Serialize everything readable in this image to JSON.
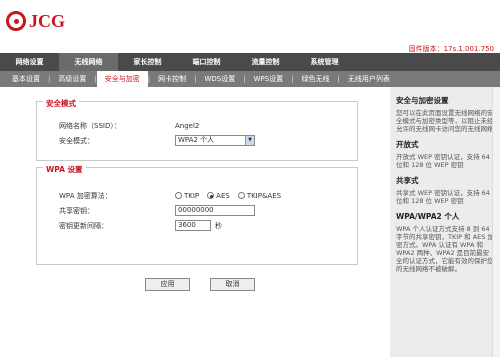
{
  "brand": {
    "name": "JCG",
    "color": "#c8161d"
  },
  "firmware": "固件版本：17s.1.001.750",
  "main_nav": [
    "网络设置",
    "无线网络",
    "家长控制",
    "端口控制",
    "流量控制",
    "系统管理"
  ],
  "main_nav_active": 1,
  "sub_nav": [
    "基本设置",
    "高级设置",
    "安全与加密",
    "网卡控制",
    "WDS设置",
    "WPS设置",
    "绿色无线",
    "无线用户列表"
  ],
  "sub_nav_active": 2,
  "security": {
    "title": "安全模式",
    "ssid_label": "网络名称（SSID）：",
    "ssid_value": "Angel2",
    "mode_label": "安全模式：",
    "mode_value": "WPA2 个人"
  },
  "wpa": {
    "title": "WPA 设置",
    "algo_label": "WPA 加密算法：",
    "algo_options": [
      "TKIP",
      "AES",
      "TKIP&AES"
    ],
    "algo_selected": 1,
    "key_label": "共享密钥：",
    "key_value": "00000000",
    "interval_label": "密钥更新间隔：",
    "interval_value": "3600",
    "interval_unit": "秒"
  },
  "buttons": {
    "apply": "应用",
    "cancel": "取消"
  },
  "sidebar": [
    {
      "title": "安全与加密设置",
      "text": "您可以在此页面设置无线网络的安全模式与加密类型等，以阻止未经允许的无线网卡访问您的无线网络"
    },
    {
      "title": "开放式",
      "text": "开放式 WEP 密钥认证，支持 64 位和 128 位 WEP 密钥"
    },
    {
      "title": "共享式",
      "text": "共享式 WEP 密钥认证，支持 64 位和 128 位 WEP 密钥"
    },
    {
      "title": "WPA/WPA2 个人",
      "text": "WPA 个人认证方式支持 8 到 64 字节的共享密钥，TKIP 和 AES 加密方式。WPA 认证有 WPA 和 WPA2 两种，WPA2 是目前最安全的认证方式，它能有效的保护您的无线网络不被破解。"
    }
  ]
}
